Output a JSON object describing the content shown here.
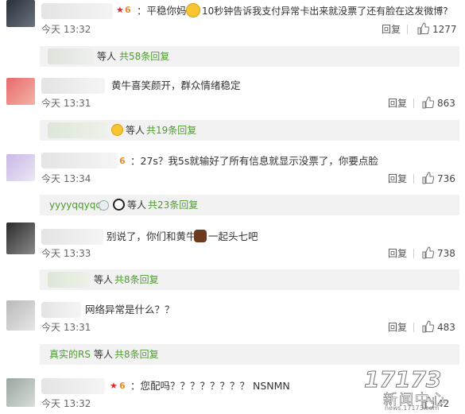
{
  "comments": [
    {
      "text": "：平稳你妈",
      "text2": "10秒钟告诉我支付异常卡出来就没票了还有脸在这发微博?",
      "time": "今天 13:32",
      "reply": "回复",
      "likes": "1277",
      "sub": {
        "user": "",
        "mid": "等人",
        "count": "共58条回复"
      }
    },
    {
      "text": "黄牛喜笑颜开，群众情绪稳定",
      "time": "今天 13:31",
      "reply": "回复",
      "likes": "863",
      "sub": {
        "user": "",
        "mid": "等人",
        "count": "共19条回复"
      }
    },
    {
      "text": "：27s？我5s就输好了所有信息就显示没票了，你要点脸",
      "time": "今天 13:34",
      "reply": "回复",
      "likes": "736",
      "sub": {
        "user": "yyyyqqyqq",
        "mid": "等人",
        "count": "共23条回复"
      }
    },
    {
      "text": "别说了，你们和黄牛",
      "text2": "一起头七吧",
      "time": "今天 13:33",
      "reply": "回复",
      "likes": "738",
      "sub": {
        "user": "",
        "mid": "等人",
        "count": "共8条回复"
      }
    },
    {
      "text": "网络异常是什么？？",
      "time": "今天 13:31",
      "reply": "回复",
      "likes": "483",
      "sub": {
        "user": "真实的RS",
        "mid": "等人",
        "count": "共8条回复"
      }
    },
    {
      "text": "：您配吗？？？？？？？？ NSNMN",
      "time": "今天 13:32",
      "reply": "回复",
      "likes": "42"
    }
  ],
  "watermark": {
    "logo": "17173",
    "name": "新闻中心",
    "url": "news.17173.com"
  },
  "colors": {
    "link_green": "#4a9e2a",
    "sub_bg": "#f2f2f2",
    "badge_orange": "#f08a24",
    "badge_red": "#e0262c"
  }
}
